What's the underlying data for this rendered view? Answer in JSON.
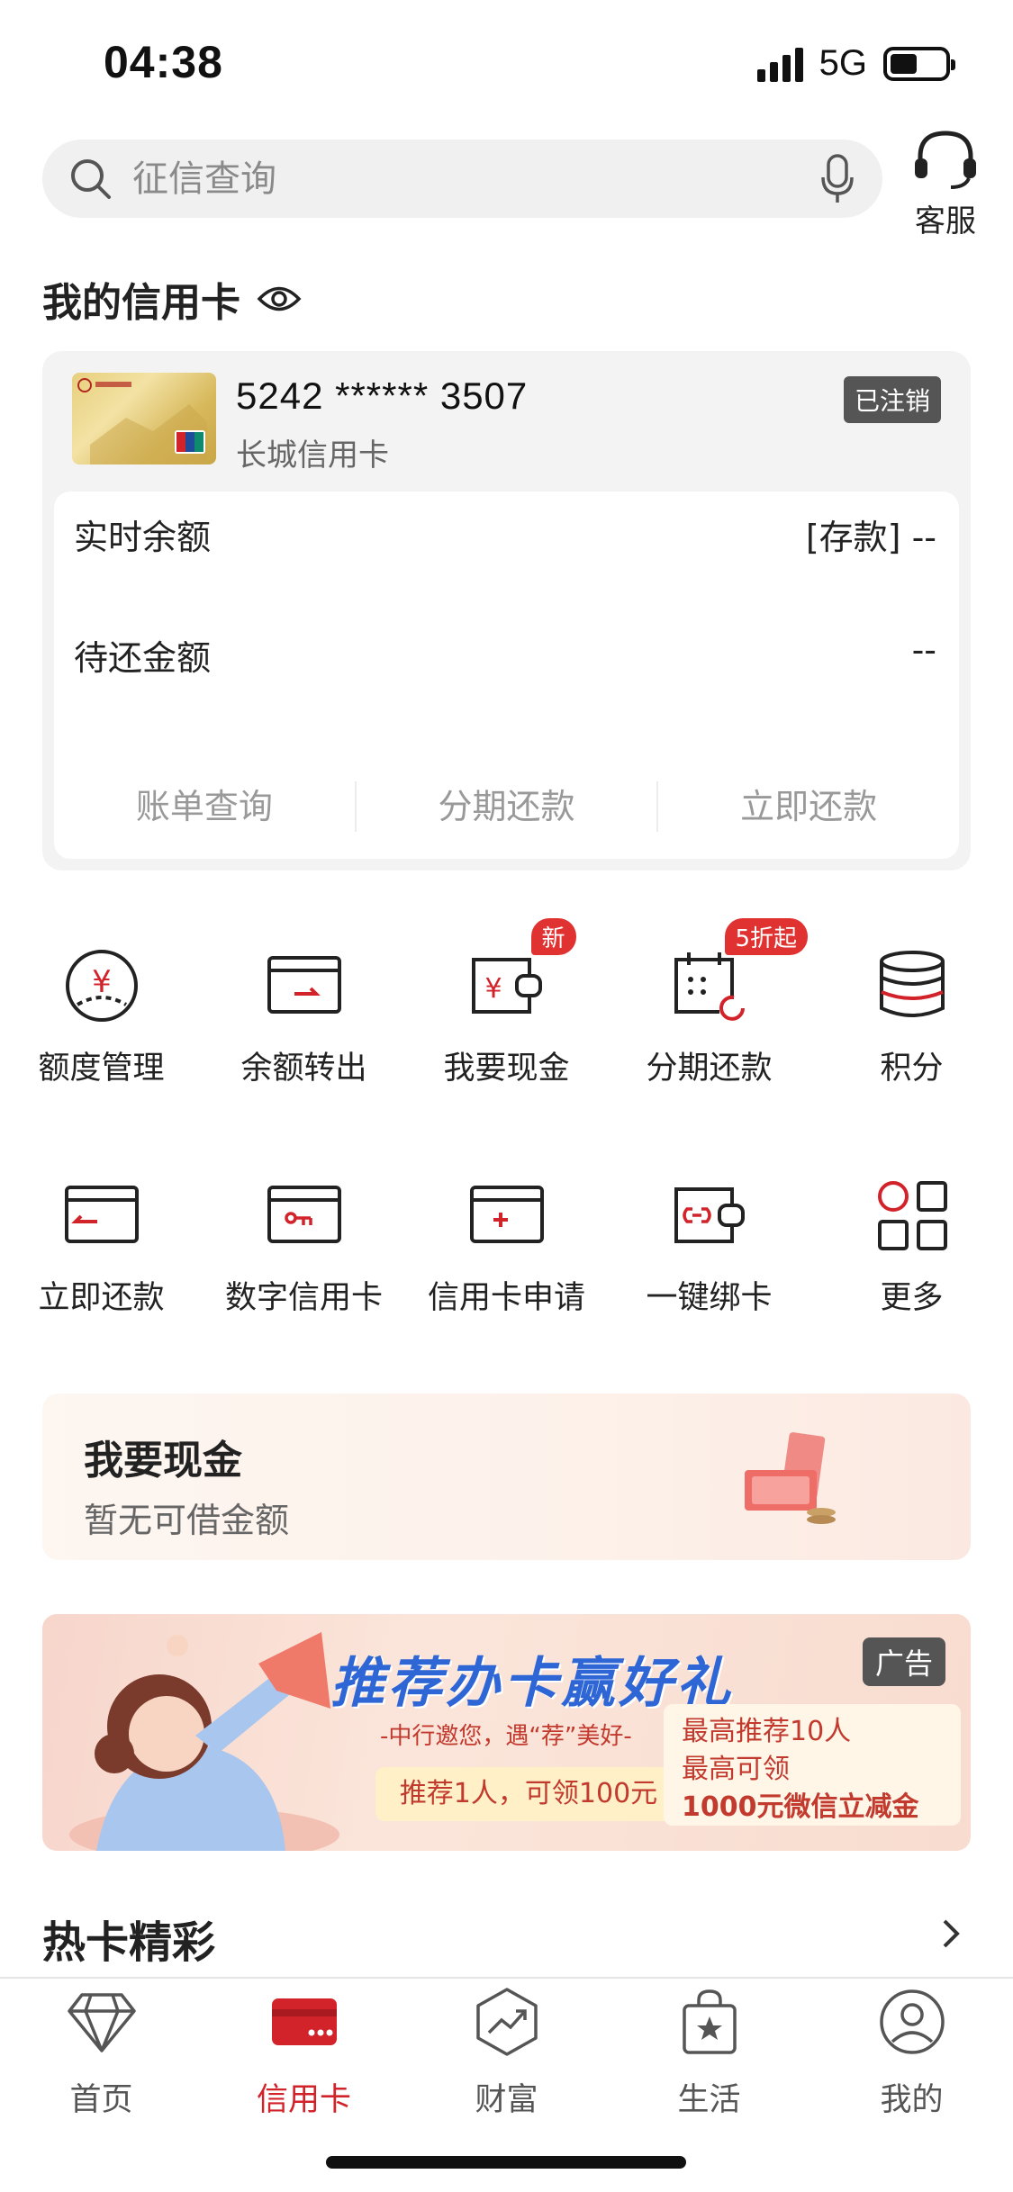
{
  "status_bar": {
    "time": "04:38",
    "network": "5G"
  },
  "search": {
    "placeholder": "征信查询"
  },
  "service": {
    "label": "客服"
  },
  "my_card": {
    "title": "我的信用卡",
    "card_number": "5242 ****** 3507",
    "card_name": "长城信用卡",
    "status_badge": "已注销",
    "realtime_balance_label": "实时余额",
    "realtime_balance_value": "[存款] --",
    "pending_label": "待还金额",
    "pending_value": "--",
    "actions": [
      "账单查询",
      "分期还款",
      "立即还款"
    ]
  },
  "grid": {
    "row1": [
      {
        "label": "额度管理",
        "icon": "quota-icon"
      },
      {
        "label": "余额转出",
        "icon": "transfer-out-icon"
      },
      {
        "label": "我要现金",
        "icon": "cash-wallet-icon",
        "badge": "新"
      },
      {
        "label": "分期还款",
        "icon": "installment-calendar-icon",
        "badge": "5折起"
      },
      {
        "label": "积分",
        "icon": "points-coins-icon"
      }
    ],
    "row2": [
      {
        "label": "立即还款",
        "icon": "repay-card-icon"
      },
      {
        "label": "数字信用卡",
        "icon": "digital-card-icon"
      },
      {
        "label": "信用卡申请",
        "icon": "apply-card-icon"
      },
      {
        "label": "一键绑卡",
        "icon": "bind-card-icon"
      },
      {
        "label": "更多",
        "icon": "more-grid-icon"
      }
    ]
  },
  "cash_banner": {
    "title": "我要现金",
    "subtitle": "暂无可借金额"
  },
  "ad": {
    "badge": "广告",
    "title": "推荐办卡赢好礼",
    "subtitle": "-中行邀您，遇“荐”美好-",
    "left_offer": "推荐1人，可领100元",
    "right_line1": "最高推荐10人",
    "right_line2": "最高可领",
    "right_line3": "1000元微信立减金"
  },
  "hot": {
    "title": "热卡精彩"
  },
  "tabbar": [
    {
      "label": "首页",
      "icon": "diamond-icon",
      "active": false
    },
    {
      "label": "信用卡",
      "icon": "credit-card-icon",
      "active": true
    },
    {
      "label": "财富",
      "icon": "wealth-chart-icon",
      "active": false
    },
    {
      "label": "生活",
      "icon": "shopping-bag-icon",
      "active": false
    },
    {
      "label": "我的",
      "icon": "profile-icon",
      "active": false
    }
  ],
  "colors": {
    "accent": "#d2232a",
    "text": "#222222",
    "muted": "#999999"
  }
}
